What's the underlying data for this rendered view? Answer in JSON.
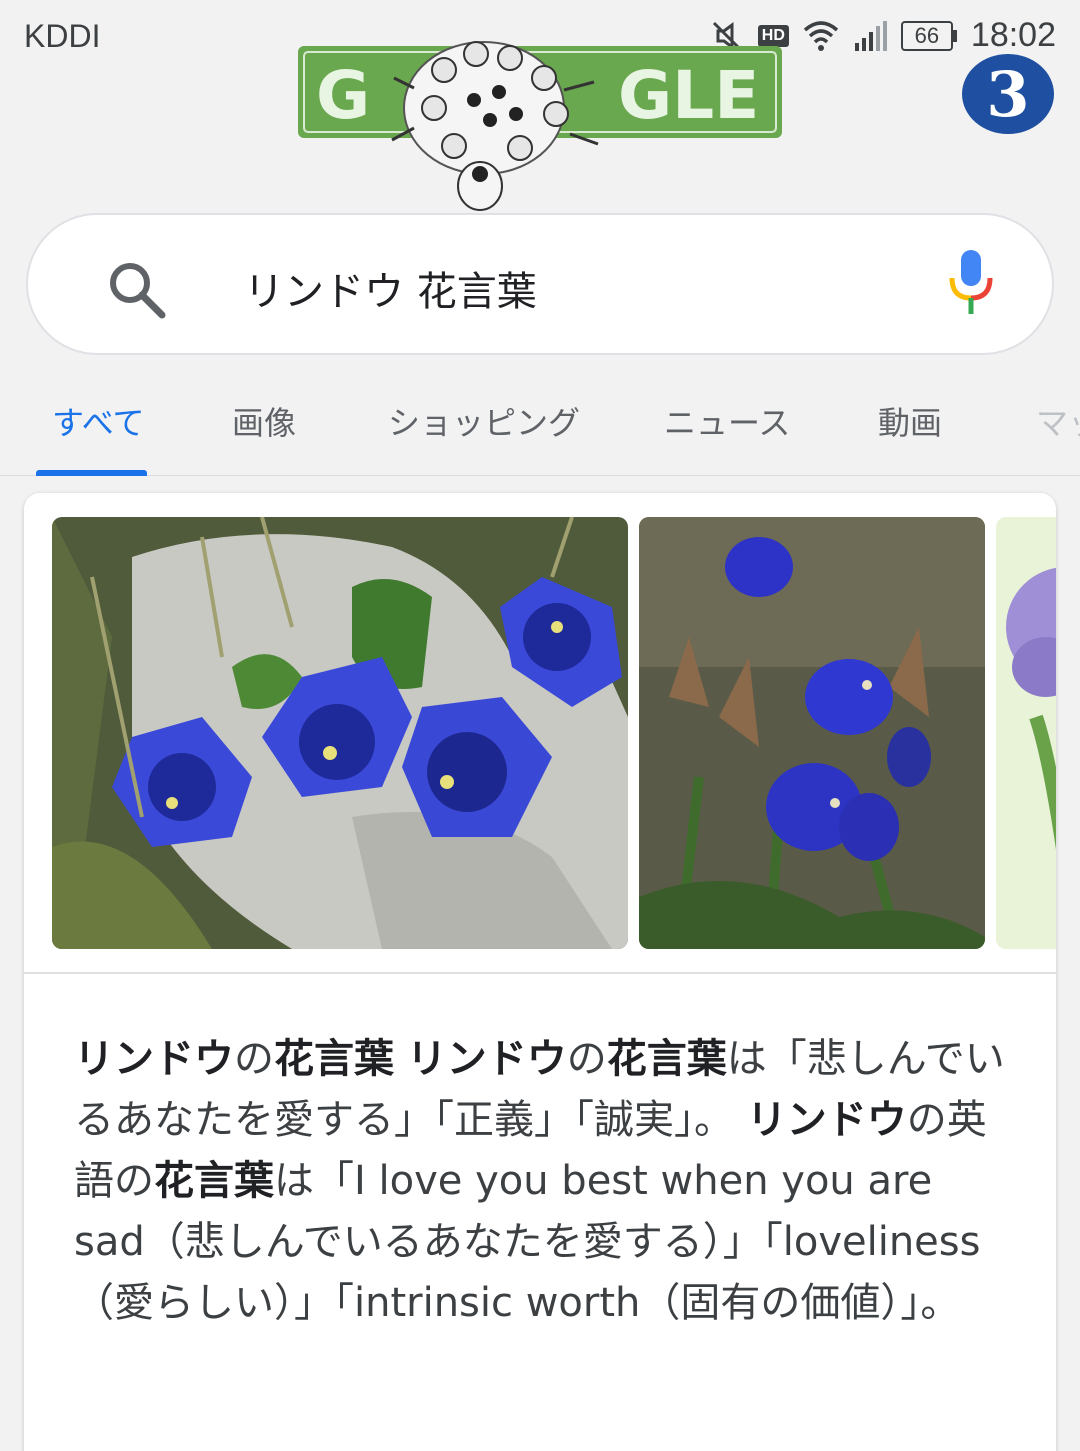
{
  "status_bar": {
    "carrier": "KDDI",
    "hd_label": "HD",
    "battery_level": "66",
    "time": "18:02"
  },
  "doodle": {
    "letters_left": "G",
    "letters_right": "GLE"
  },
  "channel_logo": {
    "text": "3"
  },
  "search": {
    "query": "リンドウ 花言葉"
  },
  "tabs": [
    {
      "label": "すべて",
      "active": true
    },
    {
      "label": "画像",
      "active": false
    },
    {
      "label": "ショッピング",
      "active": false
    },
    {
      "label": "ニュース",
      "active": false
    },
    {
      "label": "動画",
      "active": false
    },
    {
      "label": "マッ",
      "active": false
    }
  ],
  "result": {
    "snippet_parts": [
      {
        "t": "リンドウ",
        "b": true
      },
      {
        "t": "の",
        "b": false
      },
      {
        "t": "花言葉",
        "b": true
      },
      {
        "t": " ",
        "b": false
      },
      {
        "t": "リンドウ",
        "b": true
      },
      {
        "t": "の",
        "b": false
      },
      {
        "t": "花言葉",
        "b": true
      },
      {
        "t": "は「悲しんでいるあなたを愛する」「正義」「誠実」。 ",
        "b": false
      },
      {
        "t": "リンドウ",
        "b": true
      },
      {
        "t": "の英語の",
        "b": false
      },
      {
        "t": "花言葉",
        "b": true
      },
      {
        "t": "は「I love you best when you are sad（悲しんでいるあなたを愛する）」「loveliness（愛らしい）」「intrinsic worth（固有の価値）」。",
        "b": false
      }
    ]
  },
  "colors": {
    "accent": "#1a73e8",
    "doodle_green": "#6aa84f",
    "gentian_blue": "#3b49d9",
    "channel_blue": "#1f4fa0"
  }
}
